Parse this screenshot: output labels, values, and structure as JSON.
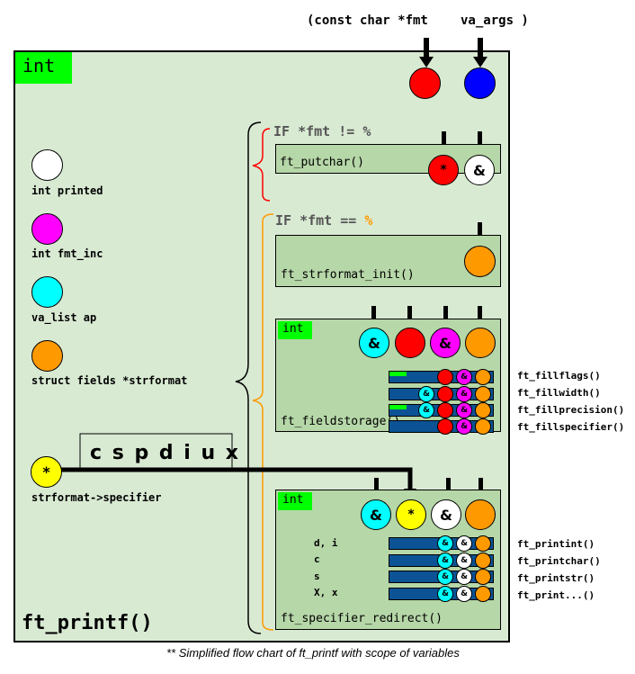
{
  "signature": {
    "open": "(const char *fmt",
    "args": "va_args )"
  },
  "return_type": "int",
  "main_function": "ft_printf()",
  "caption": "** Simplified flow chart of ft_printf with scope of variables",
  "colors": {
    "background": "#d9ead3",
    "function_box": "#b6d7a8",
    "return_tag": "#00ff00",
    "fmt": "#ff0000",
    "va_args": "#0000ff",
    "printed": "#ffffff",
    "fmt_inc": "#ff00ff",
    "ap": "#00ffff",
    "strformat": "#ff9900",
    "specifier": "#ffff00",
    "field_bar": "#0b5394",
    "branch_ne": "#ff0000",
    "branch_eq": "#ff9900"
  },
  "variables": [
    {
      "name": "int printed",
      "color": "white"
    },
    {
      "name": "int fmt_inc",
      "color": "magenta"
    },
    {
      "name": "va_list ap",
      "color": "cyan"
    },
    {
      "name": "struct fields *strformat",
      "color": "orange"
    },
    {
      "name": "strformat->specifier",
      "color": "yellow",
      "symbol": "*"
    }
  ],
  "specifier_set": "c s p d i u x",
  "branches": {
    "not_percent": {
      "prefix": "IF *fmt != ",
      "symbol": "%",
      "function": "ft_putchar()",
      "inputs": [
        {
          "symbol": "*",
          "color": "red"
        },
        {
          "symbol": "&",
          "color": "white"
        }
      ]
    },
    "percent": {
      "prefix": "IF *fmt == ",
      "symbol": "%"
    }
  },
  "functions": {
    "init": {
      "name": "ft_strformat_init()",
      "inputs": [
        {
          "symbol": "",
          "color": "orange"
        }
      ]
    },
    "fieldstorage": {
      "name": "ft_fieldstorage()",
      "return_type": "int",
      "inputs": [
        {
          "symbol": "&",
          "color": "cyan"
        },
        {
          "symbol": "",
          "color": "red"
        },
        {
          "symbol": "&",
          "color": "magenta"
        },
        {
          "symbol": "",
          "color": "orange"
        }
      ],
      "subcalls": [
        {
          "name": "ft_fillflags()",
          "returns_int": true,
          "uses_ap": false
        },
        {
          "name": "ft_fillwidth()",
          "returns_int": false,
          "uses_ap": true
        },
        {
          "name": "ft_fillprecision()",
          "returns_int": true,
          "uses_ap": true
        },
        {
          "name": "ft_fillspecifier()",
          "returns_int": false,
          "uses_ap": false
        }
      ]
    },
    "redirect": {
      "name": "ft_specifier_redirect()",
      "return_type": "int",
      "inputs": [
        {
          "symbol": "&",
          "color": "cyan"
        },
        {
          "symbol": "*",
          "color": "yellow"
        },
        {
          "symbol": "&",
          "color": "white"
        },
        {
          "symbol": "",
          "color": "orange"
        }
      ],
      "routes": [
        {
          "specifier": "d, i",
          "target": "ft_printint()"
        },
        {
          "specifier": "c",
          "target": "ft_printchar()"
        },
        {
          "specifier": "s",
          "target": "ft_printstr()"
        },
        {
          "specifier": "X, x",
          "target": "ft_print...()"
        }
      ]
    }
  },
  "symbols": {
    "amp": "&",
    "star": "*"
  }
}
